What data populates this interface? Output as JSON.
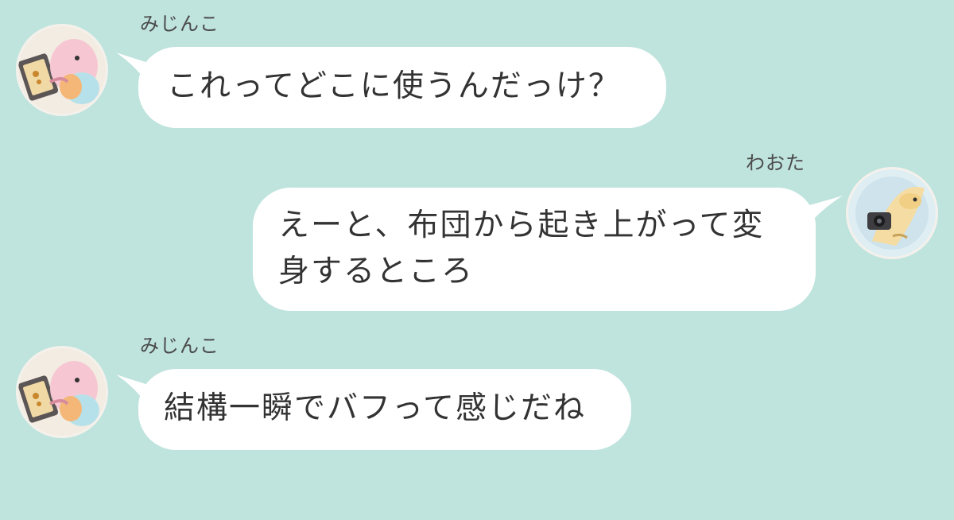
{
  "colors": {
    "background": "#bfe3dd",
    "bubble": "#ffffff",
    "text": "#333333",
    "name_text": "#4a4a4a"
  },
  "messages": [
    {
      "sender": "みじんこ",
      "side": "left",
      "avatar_icon": "mijinko-avatar-icon",
      "text": "これってどこに使うんだっけ？"
    },
    {
      "sender": "わおた",
      "side": "right",
      "avatar_icon": "waota-avatar-icon",
      "text": "えーと、布団から起き上がって変\n身するところ"
    },
    {
      "sender": "みじんこ",
      "side": "left",
      "avatar_icon": "mijinko-avatar-icon",
      "text": "結構一瞬でバフって感じだね"
    }
  ]
}
